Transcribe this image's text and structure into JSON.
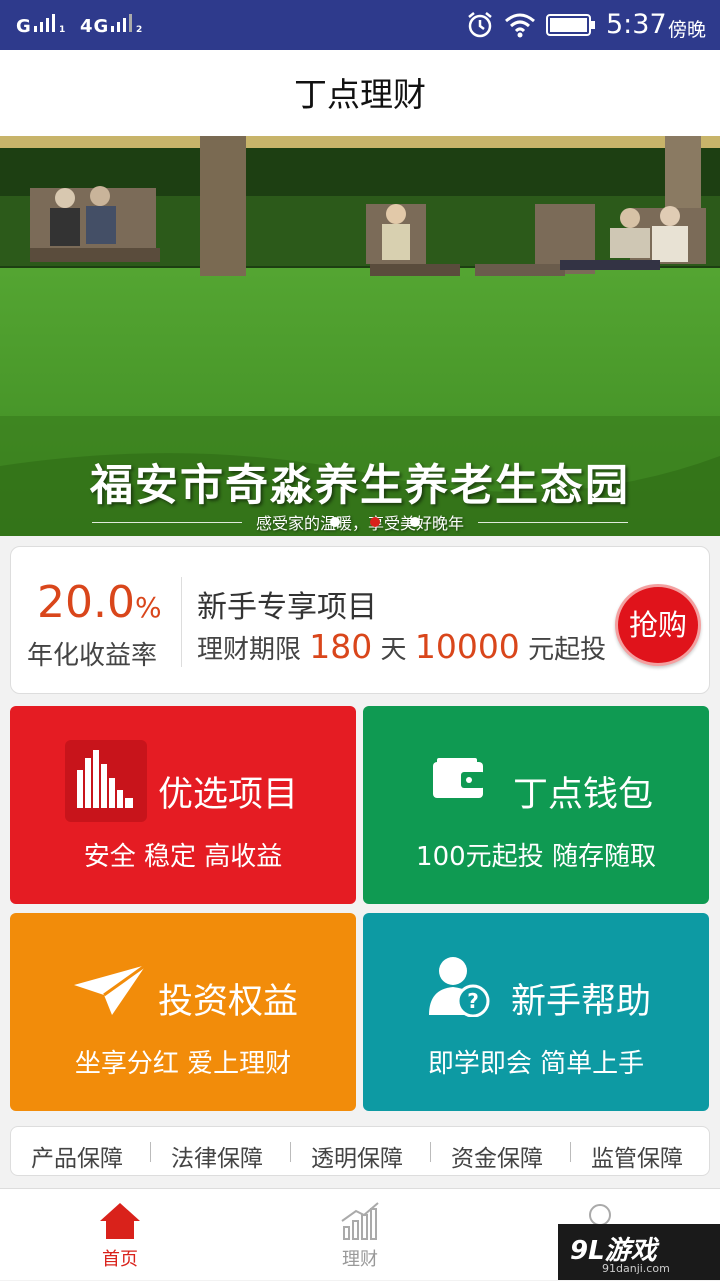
{
  "status_bar": {
    "signal_1": "G",
    "signal_2": "4G",
    "time": "5:37",
    "period": "傍晚"
  },
  "header": {
    "title": "丁点理财"
  },
  "banner": {
    "title": "福安市奇淼养生养老生态园",
    "subtitle": "感受家的温暖，享受美好晚年",
    "slide_count": 3,
    "active_slide": 2
  },
  "promo": {
    "rate_value": "20.0",
    "rate_unit": "%",
    "rate_label": "年化收益率",
    "title": "新手专享项目",
    "term_label": "理财期限",
    "term_value": "180",
    "term_unit": "天",
    "min_value": "10000",
    "min_unit": "元起投",
    "buy_label": "抢购"
  },
  "tiles": [
    {
      "title": "优选项目",
      "subtitle": "安全 稳定 高收益",
      "icon": "building-chart-icon",
      "color": "#e51c23"
    },
    {
      "title": "丁点钱包",
      "subtitle": "100元起投 随存随取",
      "icon": "wallet-icon",
      "color": "#0f9a52"
    },
    {
      "title": "投资权益",
      "subtitle": "坐享分红 爱上理财",
      "icon": "paper-plane-icon",
      "color": "#f28c0a"
    },
    {
      "title": "新手帮助",
      "subtitle": "即学即会 简单上手",
      "icon": "user-help-icon",
      "color": "#0d9aa3"
    }
  ],
  "guarantees": [
    "产品保障",
    "法律保障",
    "透明保障",
    "资金保障",
    "监管保障"
  ],
  "tabs": [
    {
      "label": "首页",
      "icon": "home-icon",
      "active": true
    },
    {
      "label": "理财",
      "icon": "finance-chart-icon",
      "active": false
    },
    {
      "label": "",
      "icon": "user-icon",
      "active": false
    }
  ],
  "watermark": {
    "logo": "9L游戏",
    "url": "91danji.com"
  },
  "colors": {
    "accent": "#d9221b",
    "status_bar": "#2e3a8c"
  }
}
